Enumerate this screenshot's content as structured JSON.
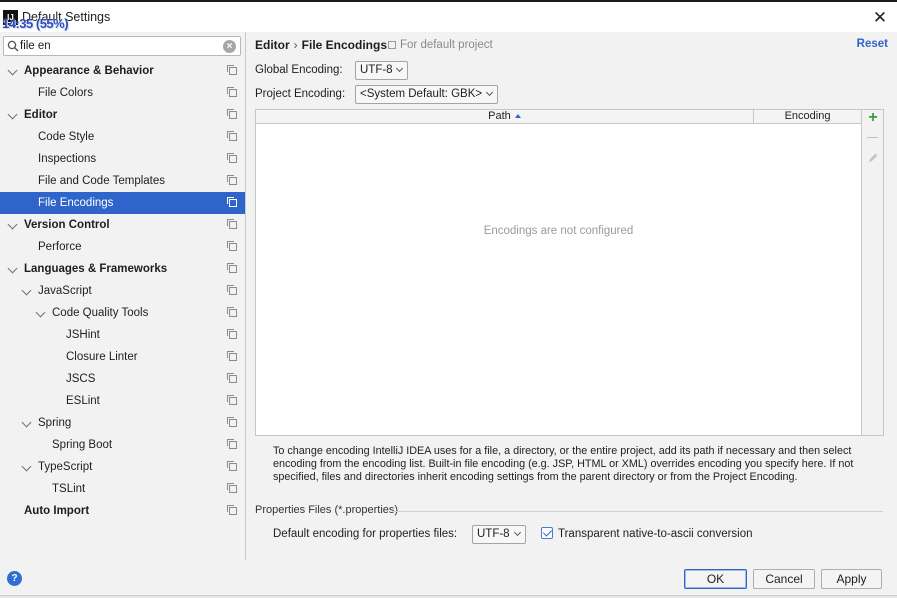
{
  "window": {
    "title": "Default Settings",
    "app_icon_text": "IJ",
    "recording_overlay": "14:35 (55%)"
  },
  "search": {
    "value": "file en",
    "placeholder": ""
  },
  "tree": [
    {
      "label": "Appearance & Behavior",
      "bold": true,
      "expanded": true,
      "level": 0
    },
    {
      "label": "File Colors",
      "level": 1
    },
    {
      "label": "Editor",
      "bold": true,
      "expanded": true,
      "level": 0
    },
    {
      "label": "Code Style",
      "level": 1
    },
    {
      "label": "Inspections",
      "level": 1
    },
    {
      "label": "File and Code Templates",
      "level": 1
    },
    {
      "label": "File Encodings",
      "level": 1,
      "selected": true
    },
    {
      "label": "Version Control",
      "bold": true,
      "expanded": true,
      "level": 0
    },
    {
      "label": "Perforce",
      "level": 1
    },
    {
      "label": "Languages & Frameworks",
      "bold": true,
      "expanded": true,
      "level": 0
    },
    {
      "label": "JavaScript",
      "expanded": true,
      "level": 1
    },
    {
      "label": "Code Quality Tools",
      "expanded": true,
      "level": 2
    },
    {
      "label": "JSHint",
      "level": 3
    },
    {
      "label": "Closure Linter",
      "level": 3
    },
    {
      "label": "JSCS",
      "level": 3
    },
    {
      "label": "ESLint",
      "level": 3
    },
    {
      "label": "Spring",
      "expanded": true,
      "level": 1
    },
    {
      "label": "Spring Boot",
      "level": 2
    },
    {
      "label": "TypeScript",
      "expanded": true,
      "level": 1
    },
    {
      "label": "TSLint",
      "level": 2
    },
    {
      "label": "Auto Import",
      "bold": true,
      "level": 0
    }
  ],
  "header": {
    "breadcrumb_parent": "Editor",
    "breadcrumb_separator": "›",
    "breadcrumb_current": "File Encodings",
    "for_default": "For default project",
    "reset": "Reset"
  },
  "encodings": {
    "global_label": "Global Encoding:",
    "global_value": "UTF-8",
    "project_label": "Project Encoding:",
    "project_value": "<System Default: GBK>"
  },
  "table": {
    "col_path": "Path",
    "col_encoding": "Encoding",
    "empty_text": "Encodings are not configured",
    "add_symbol": "+"
  },
  "help_text": "To change encoding IntelliJ IDEA uses for a file, a directory, or the entire project, add its path if necessary and then select encoding from the encoding list. Built-in file encoding (e.g. JSP, HTML or XML) overrides encoding you specify here. If not specified, files and directories inherit encoding settings from the parent directory or from the Project Encoding.",
  "properties": {
    "group_title": "Properties Files (*.properties)",
    "default_label": "Default encoding for properties files:",
    "default_value": "UTF-8",
    "transparent_label": "Transparent native-to-ascii conversion",
    "transparent_checked": true
  },
  "buttons": {
    "ok": "OK",
    "cancel": "Cancel",
    "apply": "Apply",
    "help": "?",
    "close": "✕"
  },
  "colors": {
    "accent": "#2f65ca",
    "selection": "#2f65ca",
    "add_green": "#3b9a3b"
  }
}
